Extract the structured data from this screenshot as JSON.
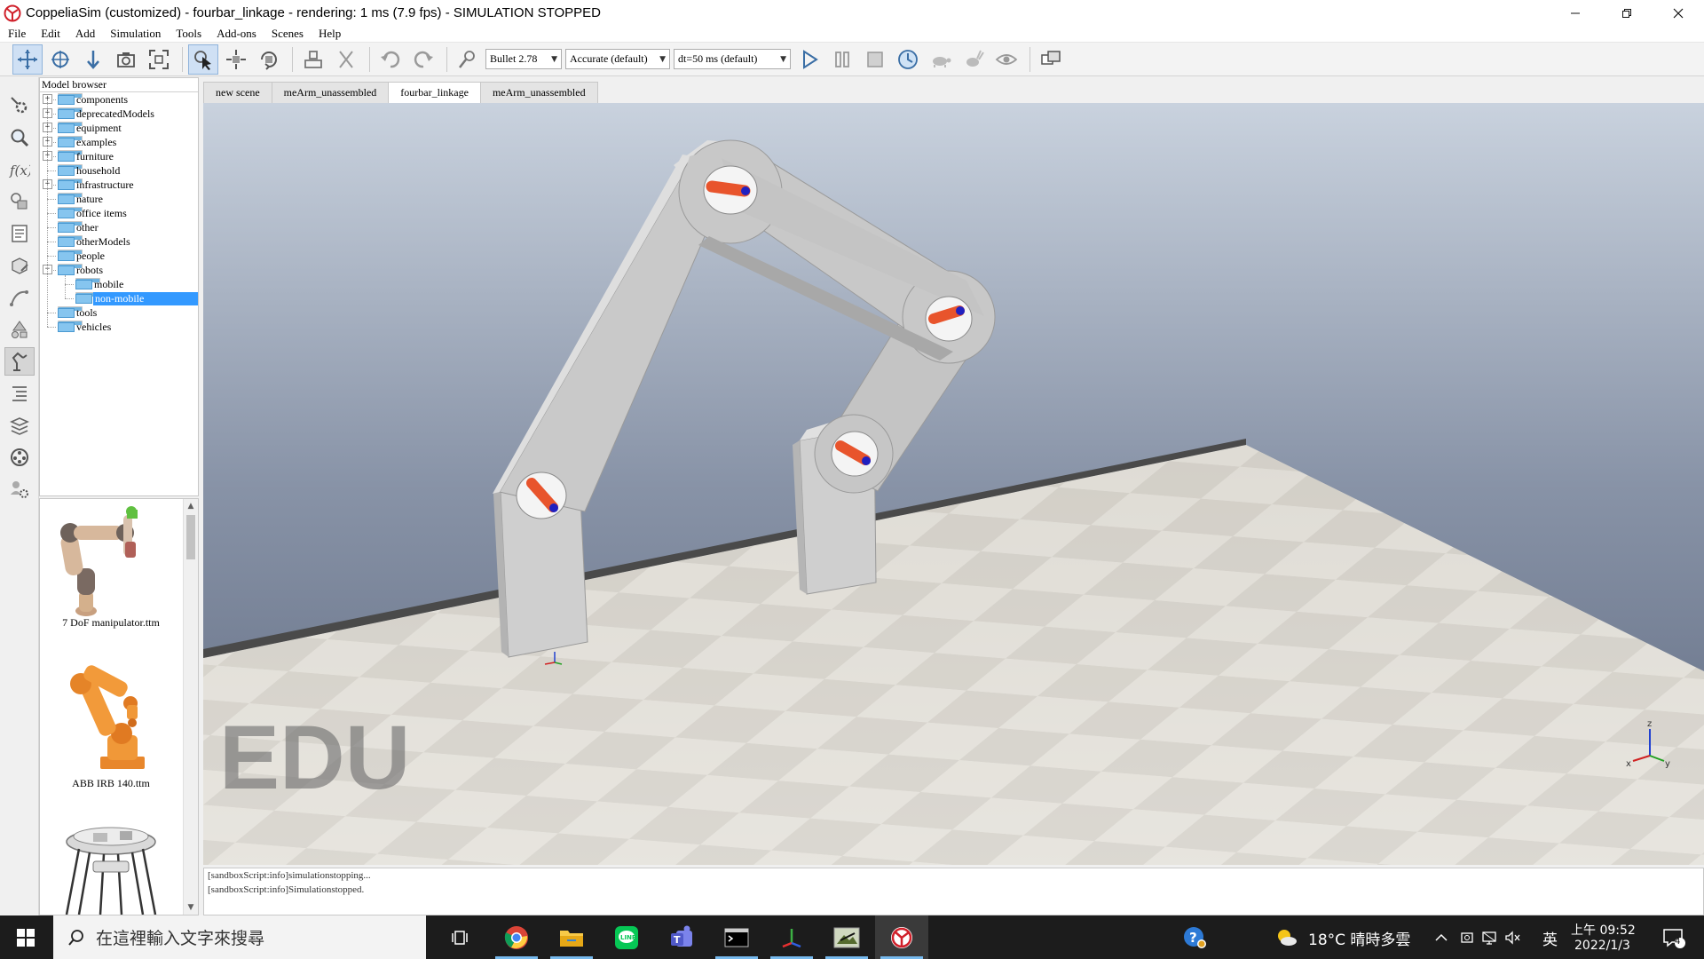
{
  "window": {
    "title": "CoppeliaSim (customized) - fourbar_linkage - rendering: 1 ms (7.9 fps) - SIMULATION STOPPED",
    "controls": [
      "minimize",
      "restore",
      "close"
    ]
  },
  "menu": [
    "File",
    "Edit",
    "Add",
    "Simulation",
    "Tools",
    "Add-ons",
    "Scenes",
    "Help"
  ],
  "toolbar": {
    "engine": "Bullet 2.78",
    "accuracy": "Accurate (default)",
    "timestep": "dt=50 ms (default)"
  },
  "model_browser": {
    "title": "Model browser",
    "folders": [
      {
        "label": "components",
        "expandable": true
      },
      {
        "label": "deprecatedModels",
        "expandable": true
      },
      {
        "label": "equipment",
        "expandable": true
      },
      {
        "label": "examples",
        "expandable": true
      },
      {
        "label": "furniture",
        "expandable": true
      },
      {
        "label": "household",
        "expandable": false
      },
      {
        "label": "infrastructure",
        "expandable": true
      },
      {
        "label": "nature",
        "expandable": false
      },
      {
        "label": "office items",
        "expandable": false
      },
      {
        "label": "other",
        "expandable": false
      },
      {
        "label": "otherModels",
        "expandable": false
      },
      {
        "label": "people",
        "expandable": false
      },
      {
        "label": "robots",
        "expandable": true,
        "expanded": true
      },
      {
        "label": "mobile",
        "child": true
      },
      {
        "label": "non-mobile",
        "child": true,
        "selected": true
      },
      {
        "label": "tools",
        "expandable": false
      },
      {
        "label": "vehicles",
        "expandable": false
      }
    ]
  },
  "thumbnails": [
    {
      "label": "7 DoF manipulator.ttm"
    },
    {
      "label": "ABB IRB 140.ttm"
    },
    {
      "label": ""
    }
  ],
  "scene_tabs": [
    {
      "label": "new scene",
      "active": false
    },
    {
      "label": "meArm_unassembled",
      "active": false
    },
    {
      "label": "fourbar_linkage",
      "active": true
    },
    {
      "label": "meArm_unassembled",
      "active": false
    }
  ],
  "viewport": {
    "watermark": "EDU",
    "axes": {
      "x": "x",
      "y": "y",
      "z": "z"
    }
  },
  "console": [
    "[sandboxScript:info]simulationstopping...",
    "[sandboxScript:info]Simulationstopped."
  ],
  "taskbar": {
    "search_placeholder": "在這裡輸入文字來搜尋",
    "weather": "18°C  晴時多雲",
    "ime": "英",
    "time_period": "上午 09:52",
    "date": "2022/1/3",
    "notification_count": "4"
  },
  "colors": {
    "selection": "#3399ff",
    "link_gray": "#c8c8c8",
    "joint_orange": "#e8542c",
    "joint_blue": "#2020c0",
    "sky_top": "#6d7a92",
    "sky_bottom": "#c9cfda"
  }
}
